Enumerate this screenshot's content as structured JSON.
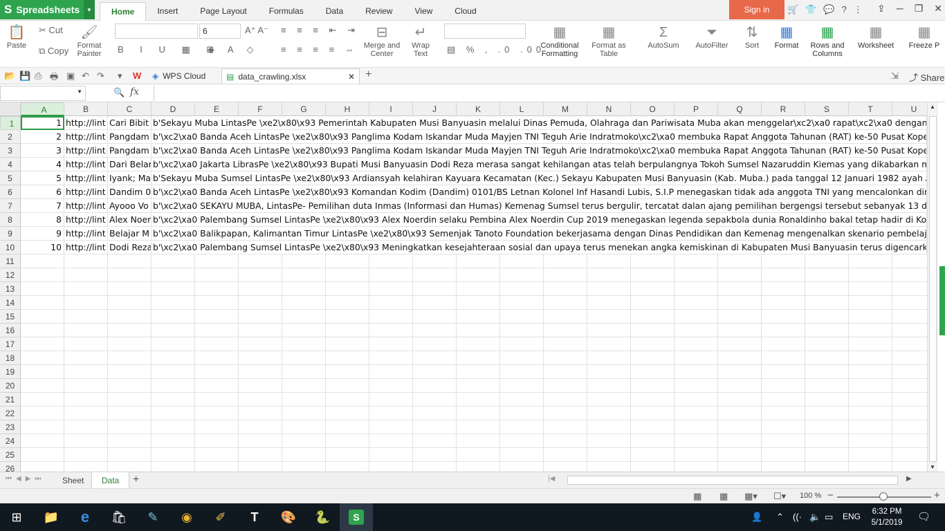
{
  "app": {
    "name": "Spreadsheets",
    "sign_in": "Sign in"
  },
  "menu_tabs": [
    "Home",
    "Insert",
    "Page Layout",
    "Formulas",
    "Data",
    "Review",
    "View",
    "Cloud"
  ],
  "ribbon": {
    "paste": "Paste",
    "cut": "Cut",
    "copy": "Copy",
    "format_painter": [
      "Format",
      "Painter"
    ],
    "font_size": "6",
    "merge_center": [
      "Merge and",
      "Center"
    ],
    "wrap_text": [
      "Wrap",
      "Text"
    ],
    "conditional_formatting": [
      "Conditional",
      "Formatting"
    ],
    "format_as_table": [
      "Format as",
      "Table"
    ],
    "autosum": "AutoSum",
    "autofilter": "AutoFilter",
    "sort": "Sort",
    "format": "Format",
    "rows_columns": [
      "Rows and",
      "Columns"
    ],
    "worksheet": "Worksheet",
    "freeze": "Freeze P"
  },
  "doc_tabs": {
    "wps_cloud": "WPS Cloud",
    "file": "data_crawling.xlsx"
  },
  "share": "Share",
  "formula_bar": {
    "fx": "fx",
    "content": ""
  },
  "columns": [
    "A",
    "B",
    "C",
    "D",
    "E",
    "F",
    "G",
    "H",
    "I",
    "J",
    "K",
    "L",
    "M",
    "N",
    "O",
    "P",
    "Q",
    "R",
    "S",
    "T",
    "U"
  ],
  "rows": [
    {
      "a": "1",
      "b": "http://lint",
      "c": "Cari Bibit",
      "d": "b'Sekayu Muba LintasPe \\xe2\\x80\\x93 Pemerintah Kabupaten Musi Banyuasin melalui Dinas Pemuda, Olahraga dan Pariwisata Muba akan menggelar\\xc2\\xa0 rapat\\xc2\\xa0 dengan pi"
    },
    {
      "a": "2",
      "b": "http://lint",
      "c": "Pangdam",
      "d": "b'\\xc2\\xa0 Banda Aceh LintasPe \\xe2\\x80\\x93 Panglima Kodam Iskandar Muda Mayjen TNI Teguh Arie Indratmoko\\xc2\\xa0 membuka Rapat Anggota Tahunan (RAT) ke-50 Pusat Kopera"
    },
    {
      "a": "3",
      "b": "http://lint",
      "c": "Pangdam",
      "d": "b'\\xc2\\xa0 Banda Aceh LintasPe \\xe2\\x80\\x93 Panglima Kodam Iskandar Muda Mayjen TNI Teguh Arie Indratmoko\\xc2\\xa0 membuka Rapat Anggota Tahunan (RAT) ke-50 Pusat Kopera"
    },
    {
      "a": "4",
      "b": "http://lint",
      "c": "Dari Belar",
      "d": "b'\\xc2\\xa0 Jakarta LibrasPe \\xe2\\x80\\x93 Bupati Musi Banyuasin Dodi Reza merasa sangat kehilangan atas telah berpulangnya Tokoh Sumsel Nazaruddin Kiemas yang dikabarkan meni"
    },
    {
      "a": "5",
      "b": "http://lint",
      "c": "Iyank; Ma",
      "d": "b'Sekayu Muba Sumsel LintasPe \\xe2\\x80\\x93 Ardiansyah kelahiran Kayuara Kecamatan (Kec.) Sekayu Kabupaten Musi Banyuasin (Kab. Muba.) pada tanggal 12 Januari 1982 ayah Amir"
    },
    {
      "a": "6",
      "b": "http://lint",
      "c": "Dandim 01",
      "d": "b'\\xc2\\xa0 Banda Aceh LintasPe \\xe2\\x80\\x93 Komandan Kodim (Dandim) 0101/BS Letnan Kolonel Inf Hasandi Lubis, S.I.P menegaskan tidak ada anggota TNI yang mencalonkan dirinya"
    },
    {
      "a": "7",
      "b": "http://lint",
      "c": "Ayooo Vo",
      "d": "b'\\xc2\\xa0 SEKAYU MUBA, LintasPe- Pemilihan duta Inmas (Informasi dan Humas) Kemenag Sumsel terus bergulir, tercatat dalan ajang pemilihan bergengsi tersebut sebanyak 13 dari l"
    },
    {
      "a": "8",
      "b": "http://lint",
      "c": "Alex Noer",
      "d": "b'\\xc2\\xa0 Palembang Sumsel LintasPe \\xe2\\x80\\x93 Alex Noerdin selaku Pembina Alex Noerdin Cup 2019 menegaskan legenda sepakbola dunia Ronaldinho bakal tetap hadir di Kota"
    },
    {
      "a": "9",
      "b": "http://lint",
      "c": "Belajar M",
      "d": "b'\\xc2\\xa0 Balikpapan, Kalimantan Timur LintasPe \\xe2\\x80\\x93 Semenjak Tanoto Foundation bekerjasama dengan Dinas Pendidikan dan Kemenag mengenalkan skenario pembelajar"
    },
    {
      "a": "10",
      "b": "http://lint",
      "c": "Dodi Reza",
      "d": "b'\\xc2\\xa0 Palembang Sumsel LintasPe \\xe2\\x80\\x93 Meningkatkan kesejahteraan sosial dan upaya terus menekan angka kemiskinan di Kabupaten Musi Banyuasin terus digencarkan"
    }
  ],
  "row_numbers": [
    "1",
    "2",
    "3",
    "4",
    "5",
    "6",
    "7",
    "8",
    "9",
    "10",
    "11",
    "12",
    "13",
    "14",
    "15",
    "16",
    "17",
    "18",
    "19",
    "20",
    "21",
    "22",
    "23",
    "24",
    "25",
    "26"
  ],
  "sheets": [
    "Sheet",
    "Data"
  ],
  "status": {
    "zoom": "100 %"
  },
  "taskbar": {
    "lang": "ENG",
    "time": "6:32 PM",
    "date": "5/1/2019"
  }
}
